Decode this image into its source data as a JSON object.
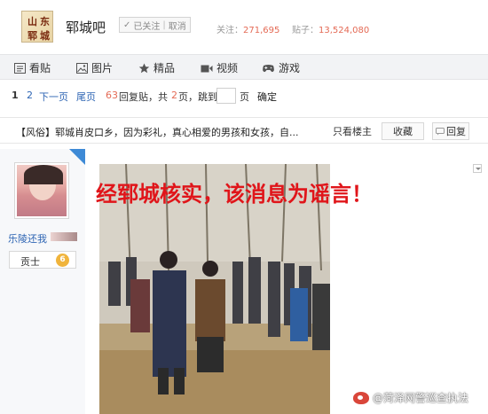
{
  "header": {
    "logo_chars": [
      "山",
      "东",
      "郓",
      "城"
    ],
    "forum_name": "郓城吧",
    "follow_state": "已关注",
    "unfollow_label": "取消",
    "followers_label": "关注：",
    "followers_count": "271,695",
    "posts_label": "贴子：",
    "posts_count": "13,524,080"
  },
  "nav": {
    "items": [
      {
        "label": "看贴",
        "icon": "list-icon"
      },
      {
        "label": "图片",
        "icon": "image-icon"
      },
      {
        "label": "精品",
        "icon": "star-icon"
      },
      {
        "label": "视频",
        "icon": "video-icon"
      },
      {
        "label": "游戏",
        "icon": "gamepad-icon"
      }
    ]
  },
  "pager": {
    "page1": "1",
    "page2": "2",
    "next": "下一页",
    "last": "尾页",
    "reply_count": "63",
    "reply_suffix": "回复贴，共",
    "total_pages": "2",
    "pages_suffix": "页，跳到",
    "page_unit": "页",
    "go": "确定"
  },
  "thread": {
    "title": "【风俗】郓城肖皮口乡，因为彩礼，真心相爱的男孩和女孩，自...",
    "only_owner": "只看楼主",
    "collect": "收藏",
    "reply": "回复"
  },
  "post": {
    "username": "乐陵还我",
    "level_title": "贡士",
    "level_num": "6",
    "headline": "经郓城核实，该消息为谣言！",
    "watermark": "@菏泽网警巡查执法"
  },
  "colors": {
    "link": "#2d64b3",
    "count": "#e46a55",
    "headline": "#e0151a"
  }
}
